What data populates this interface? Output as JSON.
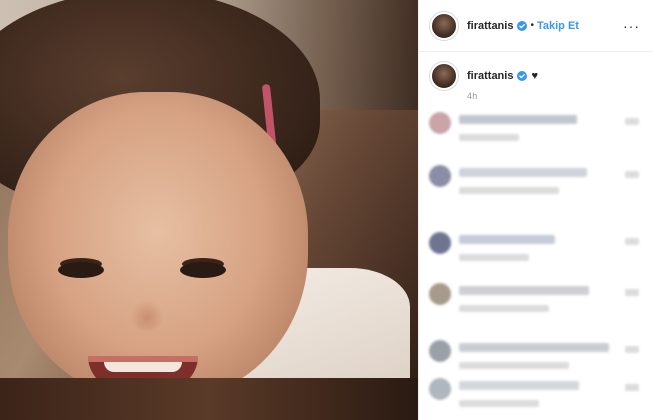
{
  "post": {
    "username": "firattanis",
    "separator": "•",
    "follow_label": "Takip Et",
    "more_glyph": "···",
    "caption_heart": "♥",
    "timestamp": "4h"
  },
  "icons": {
    "verified": "verified-badge-icon",
    "more": "more-options-icon",
    "heart": "heart-icon"
  },
  "colors": {
    "accent": "#3897f0",
    "verified": "#3897f0",
    "text": "#262626",
    "muted": "#999999",
    "border": "#efefef"
  },
  "comments_note": "",
  "comments": [
    {
      "avatar_color": "#c9a5a8",
      "line_color": "#b9bcc8"
    },
    {
      "avatar_color": "#8a8ea6",
      "line_color": "#c8cad6"
    },
    {
      "avatar_color": "#6f7590",
      "line_color": "#bdc2d2"
    },
    {
      "avatar_color": "#a89a8a",
      "line_color": "#c6c6cc"
    },
    {
      "avatar_color": "#9aa0a8",
      "line_color": "#c2c4cc"
    },
    {
      "avatar_color": "#b0b6be",
      "line_color": "#cdd0d6"
    }
  ]
}
